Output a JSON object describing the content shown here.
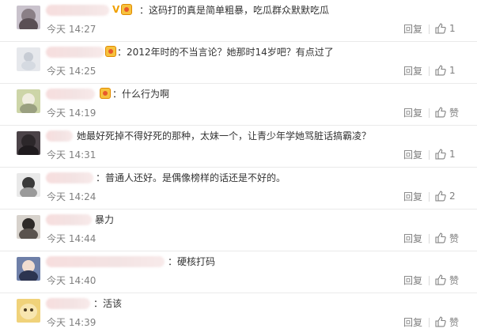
{
  "comments": [
    {
      "time": "今天 14:27",
      "text": "：这码打的真是简单粗暴，吃瓜群众默默吃瓜",
      "reply": "回复",
      "like": "1",
      "vip": "V",
      "avatar_color": "#c9c2cc"
    },
    {
      "time": "今天 14:25",
      "text": "：2012年时的不当言论？她那时14岁吧？有点过了",
      "reply": "回复",
      "like": "1",
      "vip": "",
      "avatar_color": "#e6e8ec"
    },
    {
      "time": "今天 14:19",
      "text": "：什么行为啊",
      "reply": "回复",
      "like": "赞",
      "vip": "",
      "avatar_color": "#cdd5a8"
    },
    {
      "time": "今天 14:31",
      "text": "她最好死掉不得好死的那种，太妹一个，让青少年学她骂脏话搞霸凌？",
      "reply": "回复",
      "like": "1",
      "vip": "",
      "avatar_color": "#4b4348"
    },
    {
      "time": "今天 14:24",
      "text": "：普通人还好。是偶像榜样的话还是不好的。",
      "reply": "回复",
      "like": "2",
      "vip": "",
      "avatar_color": "#e9e9e9"
    },
    {
      "time": "今天 14:44",
      "text": "暴力",
      "reply": "回复",
      "like": "赞",
      "vip": "",
      "avatar_color": "#d7d2cc"
    },
    {
      "time": "今天 14:40",
      "text": "：硬核打码",
      "reply": "回复",
      "like": "赞",
      "vip": "",
      "avatar_color": "#6e7fa8"
    },
    {
      "time": "今天 14:39",
      "text": "：活该",
      "reply": "回复",
      "like": "赞",
      "vip": "",
      "avatar_color": "#f0d27a"
    }
  ],
  "colors": {
    "accent": "#f0a000",
    "muted": "#808080",
    "divider": "#eaeaea"
  }
}
